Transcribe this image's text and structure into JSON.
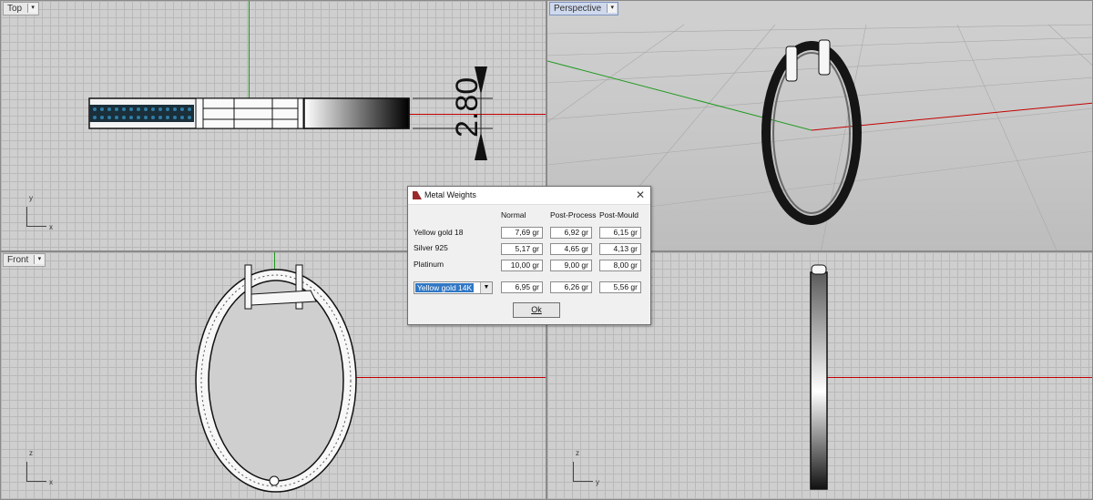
{
  "viewports": {
    "top": {
      "label": "Top"
    },
    "perspective": {
      "label": "Perspective"
    },
    "front": {
      "label": "Front"
    },
    "right": {
      "label": ""
    }
  },
  "axes": {
    "x": "x",
    "y": "y",
    "z": "z"
  },
  "dimension": {
    "value": "2.80"
  },
  "dialog": {
    "title": "Metal Weights",
    "columns": [
      "Normal",
      "Post-Process",
      "Post-Mould"
    ],
    "rows": [
      {
        "label": "Yellow gold 18",
        "values": [
          "7,69 gr",
          "6,92 gr",
          "6,15 gr"
        ]
      },
      {
        "label": "Silver 925",
        "values": [
          "5,17 gr",
          "4,65 gr",
          "4,13 gr"
        ]
      },
      {
        "label": "Platinum",
        "values": [
          "10,00 gr",
          "9,00 gr",
          "8,00 gr"
        ]
      }
    ],
    "selected_metal": "Yellow gold 14K",
    "selected_values": [
      "6,95 gr",
      "6,26 gr",
      "5,56 gr"
    ],
    "ok_label": "Ok"
  },
  "colors": {
    "x_axis": "#c40000",
    "y_axis": "#1f9a1f",
    "gem": "#1d5a7a"
  }
}
